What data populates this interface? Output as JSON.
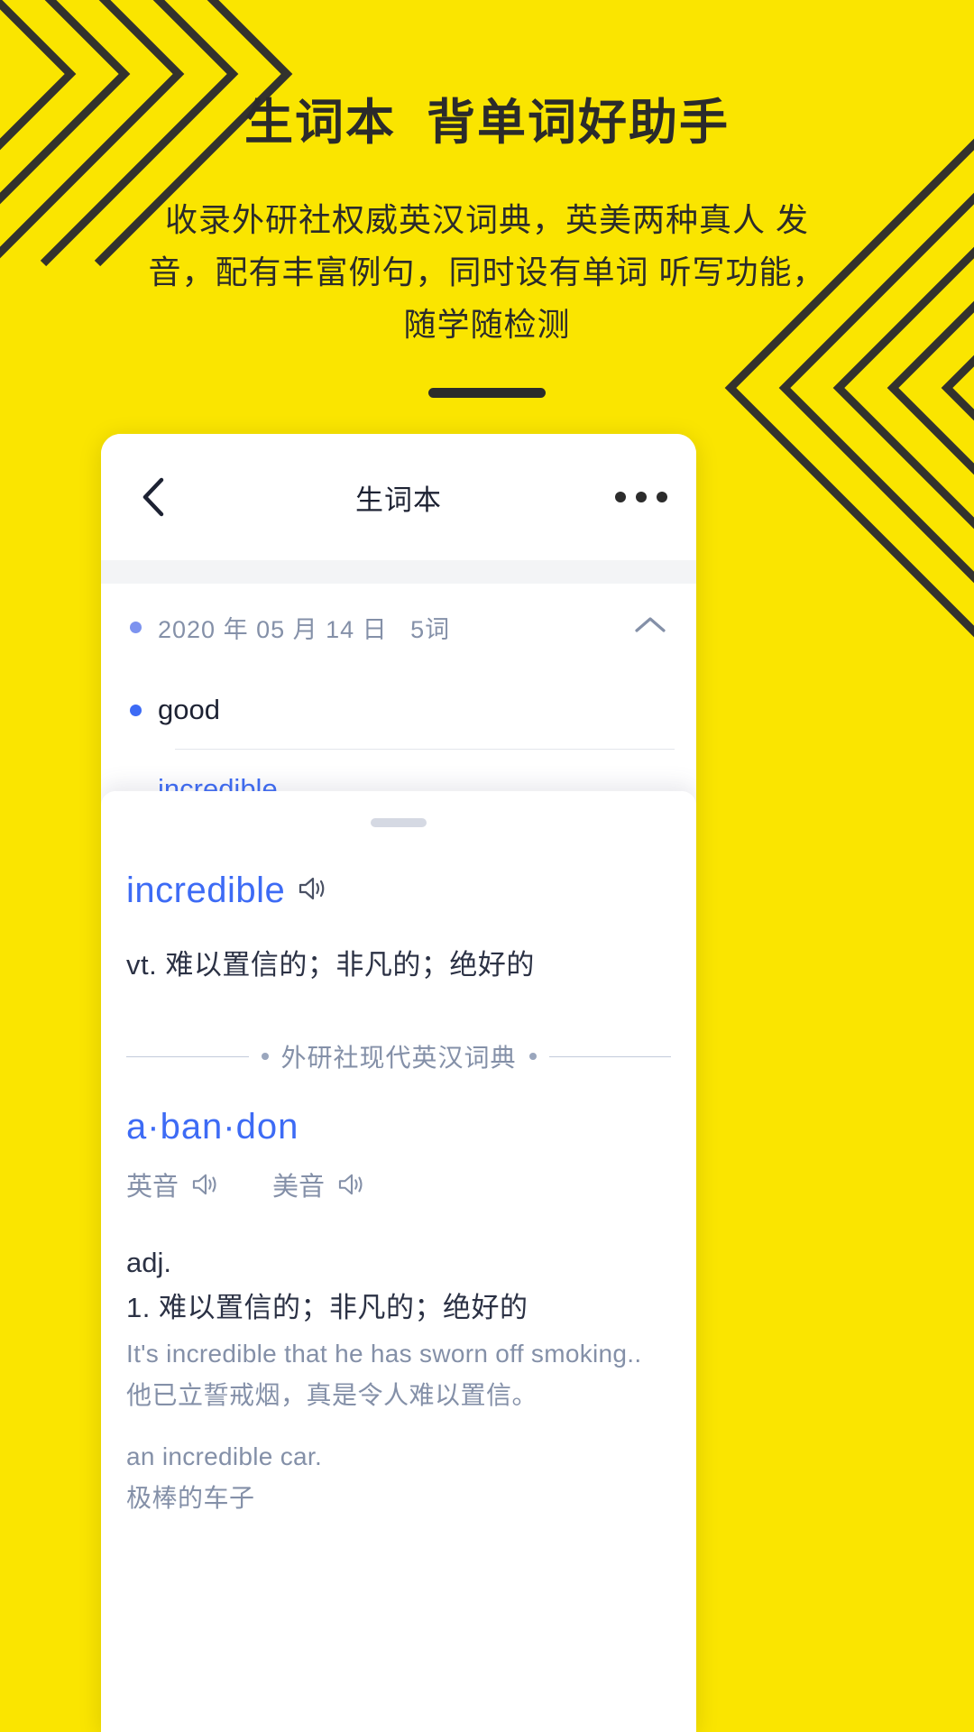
{
  "theme": {
    "background": "#FAE500",
    "ink": "#2b2b2b",
    "accent_blue": "#3d6bf5",
    "muted_blue": "#8490a8"
  },
  "promo": {
    "title": "生词本  背单词好助手",
    "subtitle": "收录外研社权威英汉词典，英美两种真人\n发音，配有丰富例句，同时设有单词\n听写功能，随学随检测"
  },
  "app": {
    "navbar": {
      "back_icon": "chevron-left-icon",
      "title": "生词本",
      "more_icon": "more-horizontal-icon"
    },
    "group": {
      "date_label": "2020 年 05 月 14 日   5词",
      "collapse_icon": "chevron-up-icon"
    },
    "words": [
      {
        "text": "good",
        "bulleted": true,
        "highlighted": false
      },
      {
        "text": "incredible",
        "bulleted": false,
        "highlighted": true
      }
    ]
  },
  "sheet": {
    "handle": "drag-handle",
    "entry": {
      "word": "incredible",
      "speaker_icon": "speaker-icon",
      "definition": "vt. 难以置信的；非凡的；绝好的"
    },
    "dictionary_source": "外研社现代英汉词典",
    "headword": "a·ban·don",
    "pronunciations": [
      {
        "label": "英音",
        "icon": "speaker-icon"
      },
      {
        "label": "美音",
        "icon": "speaker-icon"
      }
    ],
    "part_of_speech": "adj.",
    "senses": [
      {
        "number_text": "1. 难以置信的；非凡的；绝好的",
        "examples": [
          {
            "en": "It's incredible that he has sworn off smoking..",
            "zh": "他已立誓戒烟，真是令人难以置信。"
          },
          {
            "en": "an incredible car.",
            "zh": "极棒的车子"
          }
        ]
      }
    ]
  }
}
